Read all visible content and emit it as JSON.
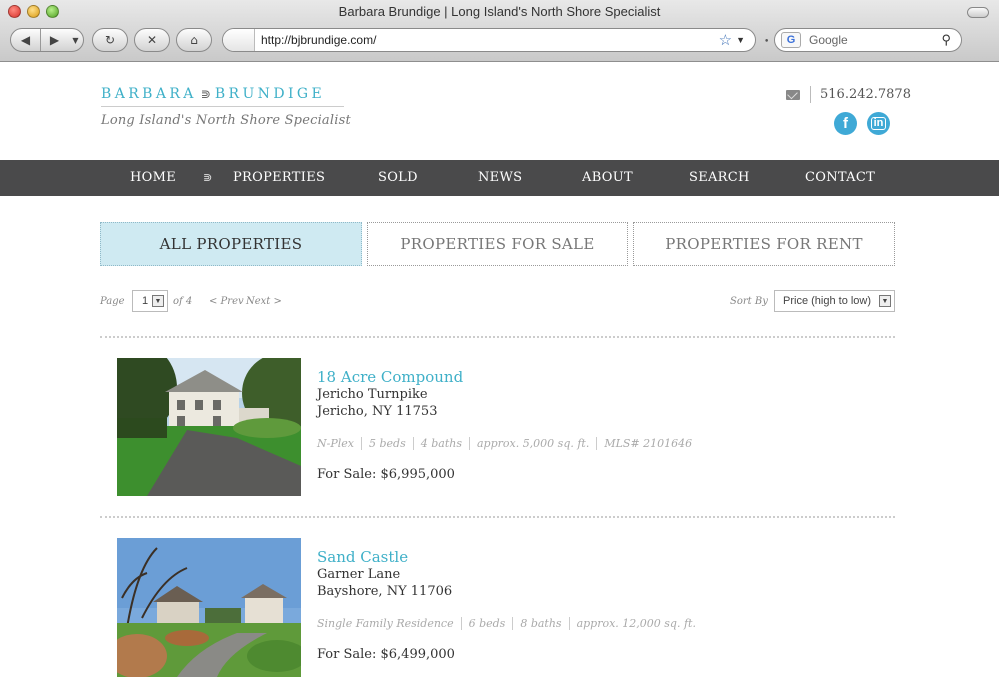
{
  "browser": {
    "window_title": "Barbara Brundige | Long Island's North Shore Specialist",
    "url": "http://bjbrundige.com/",
    "search_placeholder": "Google",
    "back_glyph": "◀",
    "forward_glyph": "▶",
    "dropdown_glyph": "▼",
    "reload_glyph": "↻",
    "stop_glyph": "✕",
    "home_glyph": "⌂",
    "star_glyph": "☆",
    "google_glyph": "G",
    "search_glyph": "⚲"
  },
  "header": {
    "logo_left": "BARBARA",
    "logo_right": "BRUNDIGE",
    "logo_fish": "⋑",
    "tagline": "Long Island's North Shore Specialist",
    "phone": "516.242.7878",
    "facebook_glyph": "f",
    "linkedin_glyph": "in"
  },
  "nav": {
    "items": [
      {
        "label": "HOME"
      },
      {
        "label": "PROPERTIES"
      },
      {
        "label": "SOLD"
      },
      {
        "label": "NEWS"
      },
      {
        "label": "ABOUT"
      },
      {
        "label": "SEARCH"
      },
      {
        "label": "CONTACT"
      }
    ],
    "fish_glyph": "⋑"
  },
  "tabs": [
    {
      "label": "ALL PROPERTIES",
      "active": true
    },
    {
      "label": "PROPERTIES FOR SALE",
      "active": false
    },
    {
      "label": "PROPERTIES FOR RENT",
      "active": false
    }
  ],
  "pagination": {
    "page_label": "Page",
    "page_value": "1",
    "of_label": "of 4",
    "prev": "< Prev",
    "next": "Next >"
  },
  "sort": {
    "label": "Sort By",
    "value": "Price (high to low)"
  },
  "listings": [
    {
      "title": "18 Acre Compound",
      "street": "Jericho Turnpike",
      "city": "Jericho, NY 11753",
      "specs": [
        "N-Plex",
        "5 beds",
        "4 baths",
        "approx. 5,000 sq. ft.",
        "MLS# 2101646"
      ],
      "price": "For Sale: $6,995,000"
    },
    {
      "title": "Sand Castle",
      "street": "Garner Lane",
      "city": "Bayshore, NY 11706",
      "specs": [
        "Single Family Residence",
        "6 beds",
        "8 baths",
        "approx. 12,000 sq. ft."
      ],
      "price": "For Sale: $6,499,000"
    }
  ],
  "colors": {
    "accent": "#3fb0c8",
    "nav_bg": "#4a4a4b",
    "active_tab": "#cfeaf2"
  }
}
